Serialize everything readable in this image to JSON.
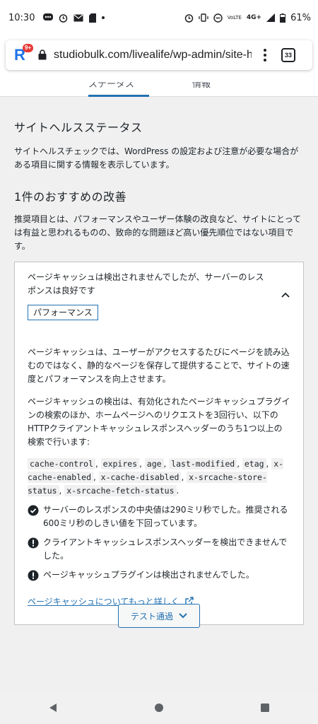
{
  "status_bar": {
    "time": "10:30",
    "network": "4G+",
    "volte": "VoLTE",
    "battery": "61%"
  },
  "browser": {
    "url": "studiobulk.com/livealife/wp-admin/site-healt",
    "tabs_count": "33",
    "app_badge": "9+"
  },
  "tabs": {
    "status_label": "ステータス",
    "info_label": "情報"
  },
  "main": {
    "title": "サイトヘルスステータス",
    "description": "サイトヘルスチェックでは、WordPress の設定および注意が必要な場合がある項目に関する情報を表示しています。",
    "recommend_title": "1件のおすすめの改善",
    "recommend_description": "推奨項目とは、パフォーマンスやユーザー体験の改良など、サイトにとっては有益と思われるものの、致命的な問題ほど高い優先順位ではない項目です。"
  },
  "panel": {
    "heading": "ページキャッシュは検出されませんでしたが、サーバーのレスポンスは良好です",
    "tag": "パフォーマンス",
    "para1": "ページキャッシュは、ユーザーがアクセスするたびにページを読み込むのではなく、静的なページを保存して提供することで、サイトの速度とパフォーマンスを向上させます。",
    "para2": "ページキャッシュの検出は、有効化されたページキャッシュプラグインの検索のほか、ホームページへのリクエストを3回行い、以下のHTTPクライアントキャッシュレスポンスヘッダーのうち1つ以上の検索で行います:",
    "headers": [
      "cache-control",
      "expires",
      "age",
      "last-modified",
      "etag",
      "x-cache-enabled",
      "x-cache-disabled",
      "x-srcache-store-status",
      "x-srcache-fetch-status"
    ],
    "status_ok": "サーバーのレスポンスの中央値は290ミリ秒でした。推奨される600ミリ秒のしきい値を下回っています。",
    "status_warn1": "クライアントキャッシュレスポンスヘッダーを検出できませんでした。",
    "status_warn2": "ページキャッシュプラグインは検出されませんでした。",
    "learn_more": "ページキャッシュについてもっと詳しく"
  },
  "pass_button": "テスト通過"
}
